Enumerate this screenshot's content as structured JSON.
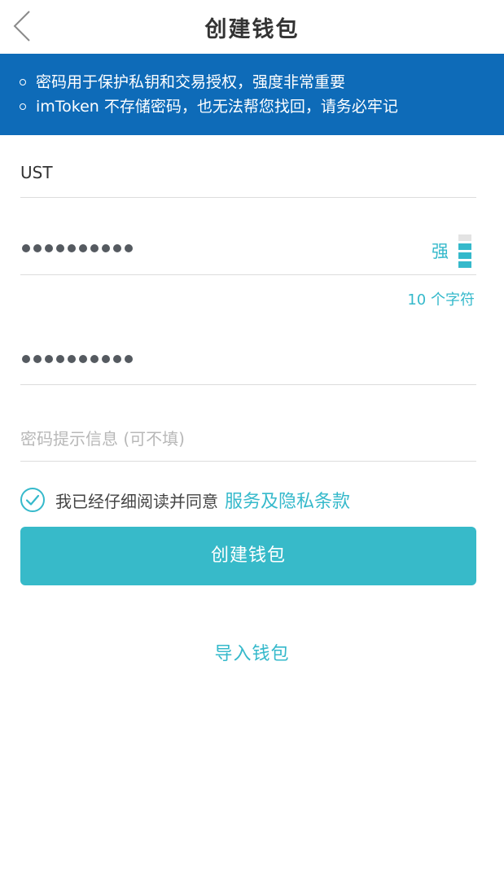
{
  "navbar": {
    "title": "创建钱包",
    "back_icon": "chevron-left-icon"
  },
  "notice": {
    "lines": [
      "密码用于保护私钥和交易授权，强度非常重要",
      "imToken 不存储密码，也无法帮您找回，请务必牢记"
    ]
  },
  "form": {
    "wallet_name": {
      "value": "UST"
    },
    "password": {
      "masked_length": 10,
      "strength_label": "强",
      "strength_level": 3,
      "strength_max": 4,
      "char_count": "10 个字符"
    },
    "confirm_password": {
      "masked_length": 10
    },
    "hint": {
      "placeholder": "密码提示信息 (可不填)"
    }
  },
  "agreement": {
    "checked": true,
    "text": "我已经仔细阅读并同意",
    "link": "服务及隐私条款"
  },
  "actions": {
    "create_label": "创建钱包",
    "import_label": "导入钱包"
  },
  "colors": {
    "brand": "#37bac9",
    "notice_bg": "#0e6bb8",
    "accent_text": "#35b9cb"
  }
}
